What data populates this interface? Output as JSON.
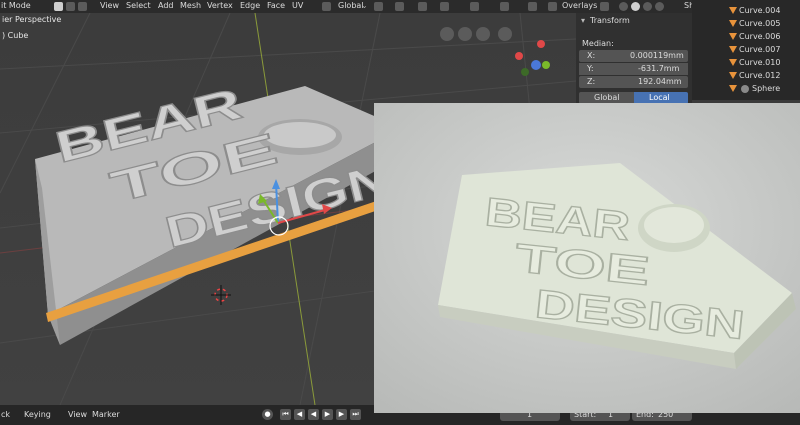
{
  "header": {
    "mode": "it Mode",
    "menus": [
      "View",
      "Select",
      "Add",
      "Mesh",
      "Vertex",
      "Edge",
      "Face",
      "UV"
    ],
    "orientation": "Global",
    "overlays": "Overlays",
    "shading_partial": "Sh"
  },
  "viewport": {
    "perspective_label": "ier Perspective",
    "object_label": ") Cube",
    "model_text": [
      "BEAR",
      "TOE",
      "DESIGN"
    ]
  },
  "npanel": {
    "title": "Transform",
    "median_label": "Median:",
    "x_label": "X:",
    "x_value": "0.000119mm",
    "y_label": "Y:",
    "y_value": "-631.7mm",
    "z_label": "Z:",
    "z_value": "192.04mm",
    "global_label": "Global",
    "local_label": "Local"
  },
  "outliner": {
    "items": [
      "Curve.004",
      "Curve.005",
      "Curve.006",
      "Curve.007",
      "Curve.010",
      "Curve.012",
      "Sphere"
    ]
  },
  "timeline": {
    "playback": "ck",
    "keying": "Keying",
    "view": "View",
    "marker": "Marker",
    "current_frame": "1",
    "start_label": "Start:",
    "start_value": "1",
    "end_label": "End:",
    "end_value": "250"
  },
  "photo": {
    "print_text": [
      "BEAR",
      "TOE",
      "DESIGN"
    ]
  },
  "colors": {
    "accent_blue": "#4772b3",
    "selection_orange": "#e8a040",
    "object_icon_orange": "#e8933b"
  }
}
